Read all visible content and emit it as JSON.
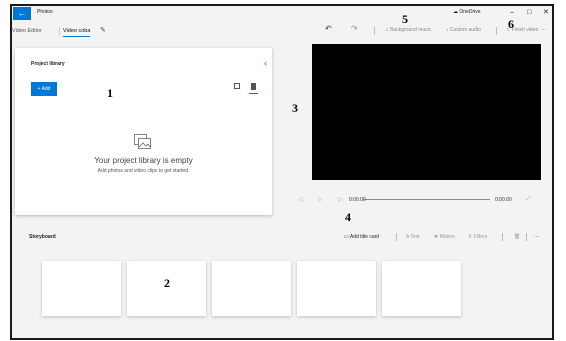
{
  "app": {
    "name": "Photos",
    "back_label": "←"
  },
  "onedrive": {
    "label": "OneDrive"
  },
  "window_controls": {
    "minimize": "–",
    "maximize": "□",
    "close": "✕"
  },
  "breadcrumb": {
    "root": "Video Editor",
    "current": "Video coba"
  },
  "top_toolbar": {
    "undo": "↶",
    "redo": "↷",
    "background_music": "Background music",
    "custom_audio": "Custom audio",
    "finish_video": "Finish video",
    "more": "···"
  },
  "library": {
    "title": "Project library",
    "collapse": "‹",
    "add_label": "+ Add",
    "empty_title": "Your project library is empty",
    "empty_subtitle": "Add photos and video clips to get started."
  },
  "playback": {
    "rewind": "◁",
    "play": "▷",
    "forward": "▷",
    "current_time": "0:00.00",
    "total_time": "0:00.00",
    "expand": "⤢"
  },
  "storyboard": {
    "title": "Storyboard",
    "add_title_card": "Add title card",
    "text": "Text",
    "motion": "Motion",
    "filters": "Filters",
    "delete": "🗑",
    "more": "···"
  },
  "callouts": [
    "1",
    "2",
    "3",
    "4",
    "5",
    "6"
  ],
  "colors": {
    "accent": "#0078d7",
    "preview": "#000000",
    "background": "#f3f3f3"
  }
}
